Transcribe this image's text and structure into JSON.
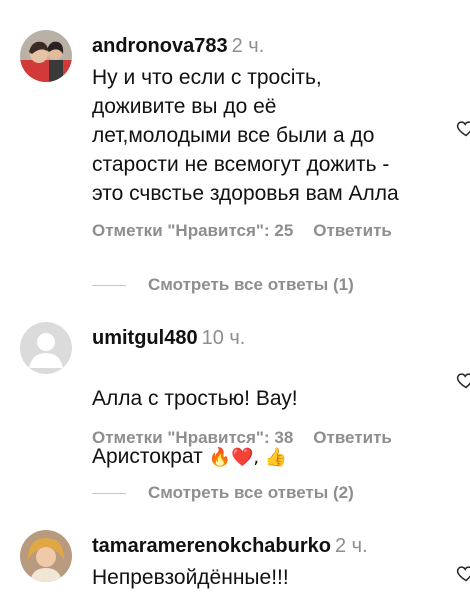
{
  "comments": [
    {
      "username": "andronova783",
      "time": "2 ч.",
      "text": "Ну и что если с тросiть,\nдоживите вы до её\nлет,молодыми все были а до\nстарости не всемогут дожить -\nэто счвстье здоровья вам Алла",
      "likes_label": "Отметки \"Нравится\": 25",
      "reply_label": "Ответить",
      "avatar_icon": "user-photo-avatar"
    },
    {
      "username": "umitgul480",
      "time": "10 ч.",
      "text_line1": "Алла с тростью! Вау!",
      "text_line2": "Аристократ",
      "text_emoji": "🔥❤️,",
      "text_emoji2": "👍",
      "likes_label": "Отметки \"Нравится\": 38",
      "reply_label": "Ответить",
      "avatar_icon": "default-person-avatar"
    },
    {
      "username": "tamaramerenokchaburko",
      "time": "2 ч.",
      "text": "Непревзойдённые!!!",
      "avatar_icon": "user-photo-avatar"
    }
  ],
  "view_replies": [
    "Смотреть все ответы (1)",
    "Смотреть все ответы (2)"
  ],
  "icons": {
    "like": "heart-outline-icon"
  },
  "colors": {
    "muted": "#8e8e8e",
    "text": "#111111",
    "divider": "#c7c7c7"
  }
}
